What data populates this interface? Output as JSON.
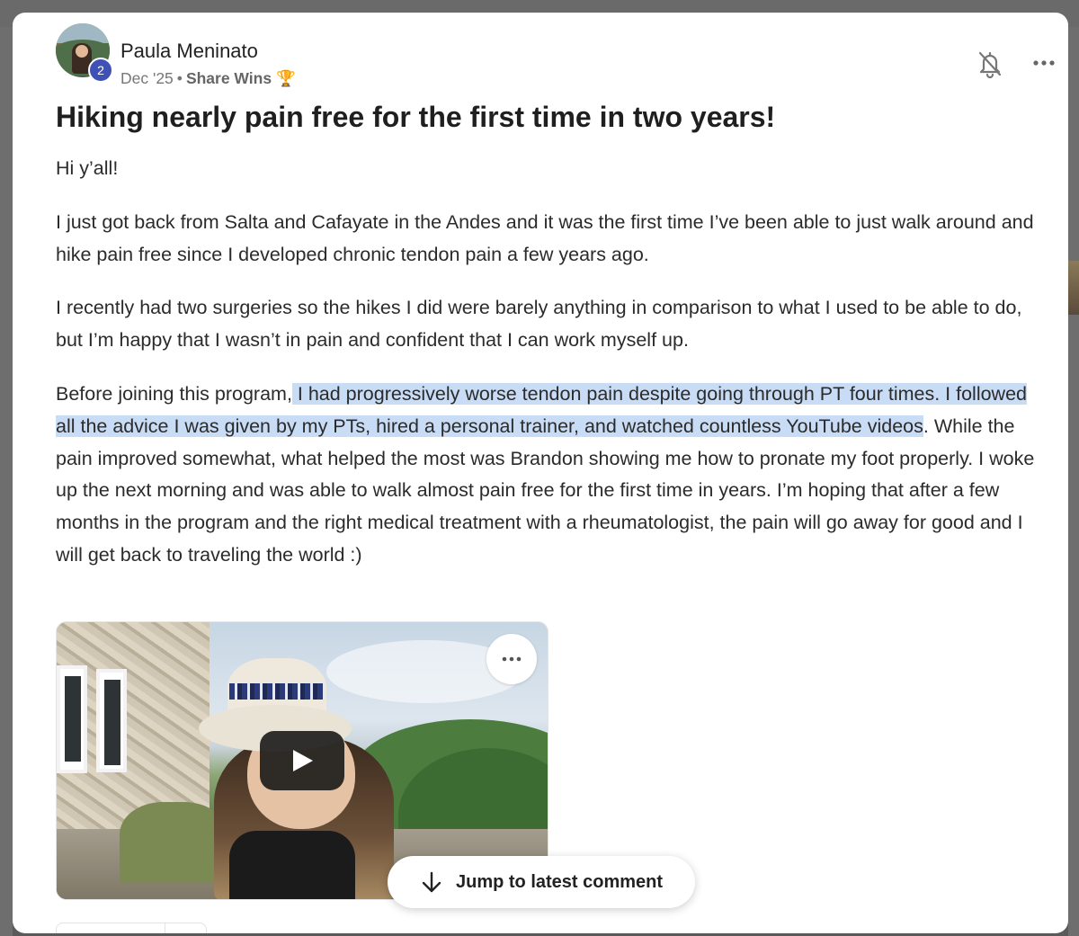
{
  "post": {
    "author": "Paula Meninato",
    "level": "2",
    "date": "Dec '25",
    "separator": "•",
    "category": "Share Wins",
    "category_emoji": "🏆",
    "title": "Hiking nearly pain free for the first time in two years!",
    "paragraphs": {
      "p1": "Hi y’all!",
      "p2": "I just got back from Salta and Cafayate in the Andes and it was the first time I’ve been able to just walk around and hike pain free since I developed chronic tendon pain a few years ago.",
      "p3": "I recently had two surgeries so the hikes I did were barely anything in comparison to what I used to be able to do, but I’m happy that I wasn’t in pain and confident that I can work myself up.",
      "p4_before": "Before joining this program,",
      "p4_highlight": " I had progressively worse tendon pain despite going through PT four times. I followed all the advice I was given by my PTs, hired a personal trainer, and watched countless YouTube videos",
      "p4_after": ". While the pain improved somewhat, what helped the most was Brandon showing me how to pronate my foot properly. I woke up the next morning and was able to walk almost pain free for the first time in years. I’m hoping that after a few months in the program and the right medical treatment with a rheumatologist, the pain will go away for good and I will get back to traveling the world :)"
    }
  },
  "actions": {
    "bell_icon": "bell-off-icon",
    "more_icon": "more-horizontal-icon"
  },
  "video": {
    "play_icon": "play-icon",
    "more_icon": "more-horizontal-icon"
  },
  "jump_button": {
    "label": "Jump to latest comment",
    "icon": "arrow-down-icon"
  },
  "colors": {
    "highlight": "#c9dcf6",
    "level_badge": "#3f51b5",
    "backdrop": "#5e5e5e"
  }
}
